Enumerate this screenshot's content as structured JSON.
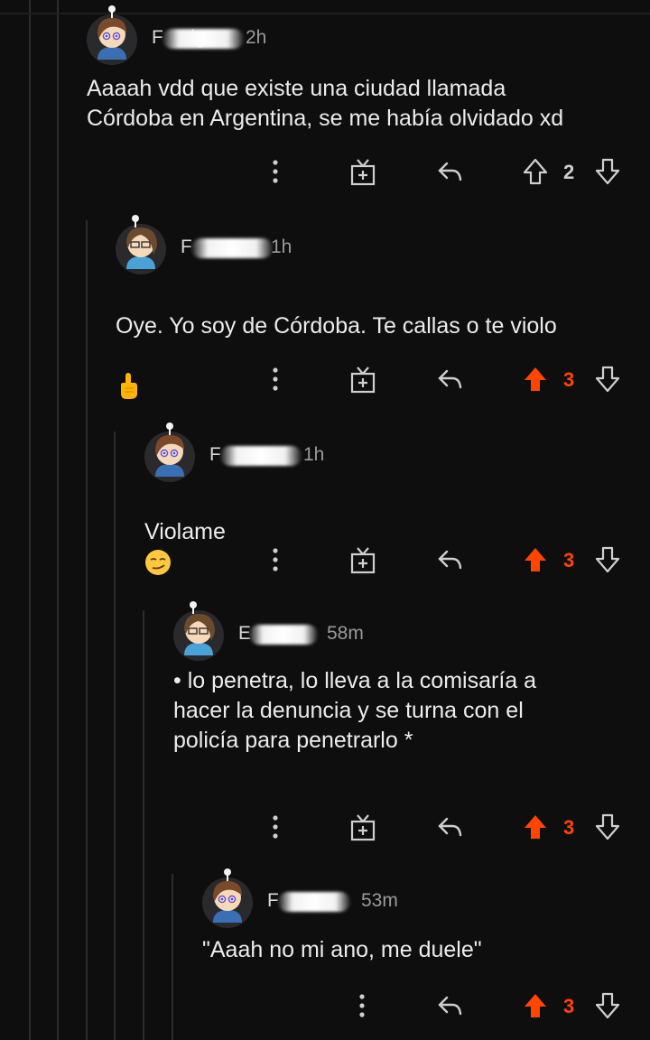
{
  "comments": [
    {
      "username": "F  nvigo",
      "time": "2h",
      "text": "Aaaah vdd que existe una ciudad llamada\nCórdoba en Argentina, se me había olvidado xd",
      "votes": "2",
      "upvoted": false
    },
    {
      "username": "F",
      "time": "1h",
      "text": "Oye. Yo soy de Córdoba. Te callas o te violo",
      "emoji": "pointing-up-hand",
      "votes": "3",
      "upvoted": true
    },
    {
      "username": "F",
      "time": "1h",
      "text": "Violame",
      "emoji": "smirking-face",
      "votes": "3",
      "upvoted": true
    },
    {
      "username": "E",
      "time": "58m",
      "text": "• lo penetra, lo lleva a la comisaría a\nhacer la denuncia y se turna con el\npolicía para penetrarlo *",
      "votes": "3",
      "upvoted": true
    },
    {
      "username": "F",
      "time": "53m",
      "text": "\"Aaah no mi ano, me duele\"",
      "votes": "3",
      "upvoted": true
    }
  ],
  "colors": {
    "upvote_active": "#ff4500",
    "icon_gray": "#cfcfcf",
    "background": "#0e0e0f"
  }
}
